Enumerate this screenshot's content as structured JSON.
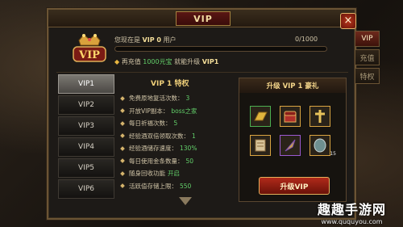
{
  "window": {
    "title": "VIP",
    "close_label": "×"
  },
  "side_tabs": [
    {
      "label": "VIP"
    },
    {
      "label": "充值"
    },
    {
      "label": "特权"
    }
  ],
  "header": {
    "badge_text": "VIP",
    "status_prefix": "您现在是",
    "status_level": "VIP 0",
    "status_suffix": "用户",
    "progress_text": "0/1000",
    "progress_fraction": 0,
    "recharge_prefix": "再充值",
    "recharge_amount": "1000元宝",
    "recharge_mid": "就能升级",
    "recharge_level": "VIP1"
  },
  "levels": [
    {
      "label": "VIP1",
      "active": true
    },
    {
      "label": "VIP2"
    },
    {
      "label": "VIP3"
    },
    {
      "label": "VIP4"
    },
    {
      "label": "VIP5"
    },
    {
      "label": "VIP6"
    }
  ],
  "privileges": {
    "title": "VIP 1 特权",
    "items": [
      {
        "label": "免费原地复活次数：",
        "value": "3"
      },
      {
        "label": "开放VIP副本：",
        "value": "boss之家"
      },
      {
        "label": "每日祈福次数：",
        "value": "5"
      },
      {
        "label": "经验酒双倍领取次数：",
        "value": "1"
      },
      {
        "label": "经验酒储存速度：",
        "value": "130%"
      },
      {
        "label": "每日使用金条数量：",
        "value": "50"
      },
      {
        "label": "随身回收功能",
        "value": "开启"
      },
      {
        "label": "活跃值存储上限：",
        "value": "550"
      }
    ]
  },
  "gift": {
    "title": "升级 VIP 1 豪礼",
    "items": [
      {
        "icon": "gold-bar-icon",
        "rarity": "green",
        "qty": ""
      },
      {
        "icon": "treasure-chest-icon",
        "rarity": "gold",
        "qty": ""
      },
      {
        "icon": "golden-cross-icon",
        "rarity": "gold",
        "qty": ""
      },
      {
        "icon": "scroll-icon",
        "rarity": "gold",
        "qty": ""
      },
      {
        "icon": "feather-quill-icon",
        "rarity": "purple",
        "qty": ""
      },
      {
        "icon": "shield-stone-icon",
        "rarity": "gold",
        "qty": "15"
      }
    ],
    "button_label": "升级VIP"
  },
  "watermark": {
    "main": "趣趣手游网",
    "url": "www.ququyou.com"
  }
}
